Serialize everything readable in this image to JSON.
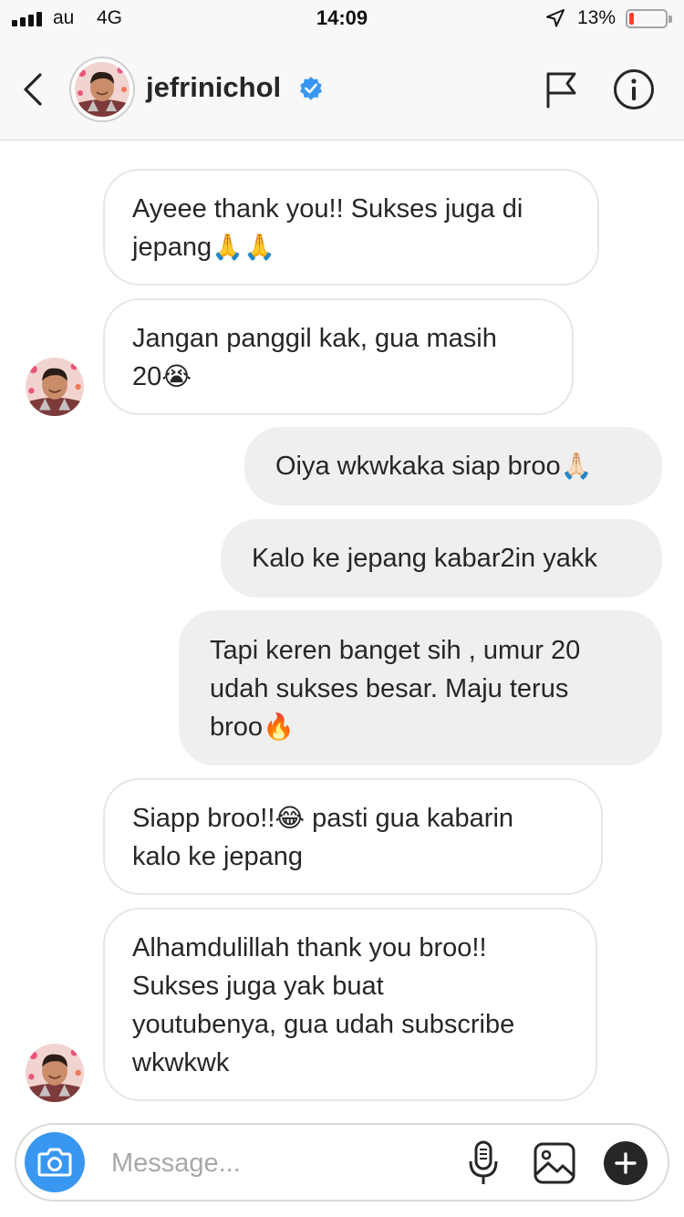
{
  "status_bar": {
    "carrier": "au",
    "network": "4G",
    "time": "14:09",
    "battery_percent": "13%",
    "battery_level": 0.13
  },
  "header": {
    "username": "jefrinichol",
    "verified": true
  },
  "messages": [
    {
      "direction": "incoming",
      "text": "Ayeee thank you!! Sukses juga di",
      "text2": "jepang",
      "emoji": "🙏🙏"
    },
    {
      "direction": "incoming",
      "text": "Jangan panggil kak, gua masih",
      "text2": "20",
      "emoji": "😭"
    },
    {
      "direction": "outgoing",
      "text": "Oiya wkwkaka siap broo",
      "emoji": "🙏🏻"
    },
    {
      "direction": "outgoing",
      "text": "Kalo ke jepang kabar2in yakk"
    },
    {
      "direction": "outgoing",
      "text": "Tapi keren banget sih , umur 20",
      "text2": "udah sukses besar. Maju terus",
      "text3": "broo",
      "emoji": "🔥"
    },
    {
      "direction": "incoming",
      "text": "Siapp broo!!",
      "emoji": "😂",
      "text_after": " pasti gua kabarin",
      "text2": "kalo ke jepang"
    },
    {
      "direction": "incoming",
      "text": "Alhamdulillah thank you broo!!",
      "text2": "Sukses juga yak buat",
      "text3": "youtubenya, gua udah subscribe",
      "text4": "wkwkwk"
    }
  ],
  "composer": {
    "placeholder": "Message..."
  },
  "colors": {
    "accent": "#3897f0",
    "verified": "#3897f0",
    "battery_low": "#ff3b30",
    "outgoing_bubble": "#efefef"
  },
  "icons": {
    "back": "chevron-left-icon",
    "flag": "flag-icon",
    "info": "info-icon",
    "camera": "camera-icon",
    "mic": "microphone-icon",
    "gallery": "image-icon",
    "plus": "plus-icon"
  }
}
